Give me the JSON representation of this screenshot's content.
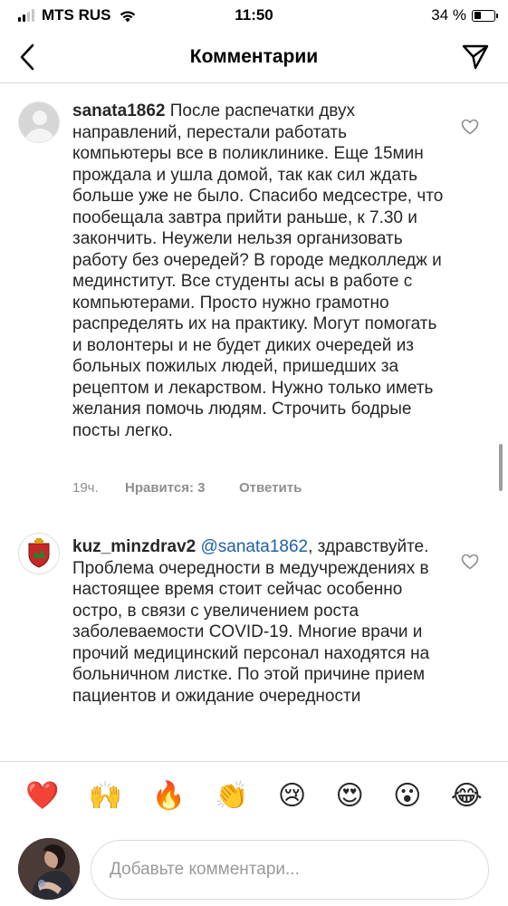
{
  "status_bar": {
    "carrier": "MTS RUS",
    "time": "11:50",
    "battery_percent": "34 %",
    "battery_level": 0.34
  },
  "nav": {
    "title": "Комментарии",
    "back_icon": "chevron-left-icon",
    "send_icon": "paper-plane-icon"
  },
  "comments": [
    {
      "username": "sanata1862",
      "text": "После распечатки двух направлений, перестали работать компьютеры все в поликлинике. Еще 15мин прождала и ушла домой, так как сил ждать больше уже не было. Спасибо медсестре, что пообещала завтра прийти раньше, к 7.30 и закончить. Неужели нельзя организовать работу без очередей? В городе медколледж и мединститут. Все студенты асы в работе с компьютерами. Просто нужно грамотно распределять их на практику. Могут помогать и волонтеры и не будет диких очередей из больных пожилых людей, пришедших за рецептом и лекарством. Нужно только иметь желания помочь людям. Строчить бодрые посты легко.",
      "time": "19ч.",
      "likes": "Нравится: 3",
      "reply": "Ответить"
    },
    {
      "username": "kuz_minzdrav2",
      "mention": "@sanata1862",
      "text": ", здравствуйте. Проблема очередности в медучреждениях в настоящее время стоит сейчас особенно остро, в связи с увеличением роста заболеваемости COVID-19. Многие врачи и прочий медицинский персонал находятся на больничном листке. По этой причине прием пациентов и ожидание очередности"
    }
  ],
  "emoji_bar": [
    "❤️",
    "🙌",
    "🔥",
    "👏",
    "😢",
    "😍",
    "😮",
    "😂"
  ],
  "comment_input": {
    "placeholder": "Добавьте комментари...",
    "value": ""
  }
}
